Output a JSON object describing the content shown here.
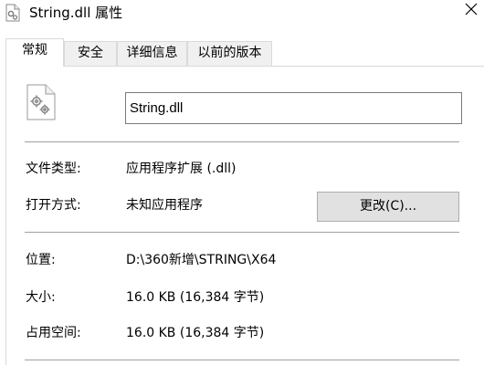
{
  "window": {
    "title": "String.dll 属性"
  },
  "tabs": [
    {
      "label": "常规",
      "active": true
    },
    {
      "label": "安全",
      "active": false
    },
    {
      "label": "详细信息",
      "active": false
    },
    {
      "label": "以前的版本",
      "active": false
    }
  ],
  "general": {
    "file_name": "String.dll",
    "file_type_label": "文件类型:",
    "file_type_value": "应用程序扩展 (.dll)",
    "opens_with_label": "打开方式:",
    "opens_with_value": "未知应用程序",
    "change_button": "更改(C)...",
    "location_label": "位置:",
    "location_value": "D:\\360新增\\STRING\\X64",
    "size_label": "大小:",
    "size_value": "16.0 KB (16,384 字节)",
    "size_on_disk_label": "占用空间:",
    "size_on_disk_value": "16.0 KB (16,384 字节)"
  },
  "icons": {
    "title": "dll-file-icon",
    "file": "dll-file-gear-icon",
    "close": "close-icon"
  },
  "colors": {
    "tab_inactive_bg": "#f0f0f0",
    "button_bg": "#e1e1e1",
    "border": "#d9d9d9",
    "divider": "#a0a0a0"
  }
}
